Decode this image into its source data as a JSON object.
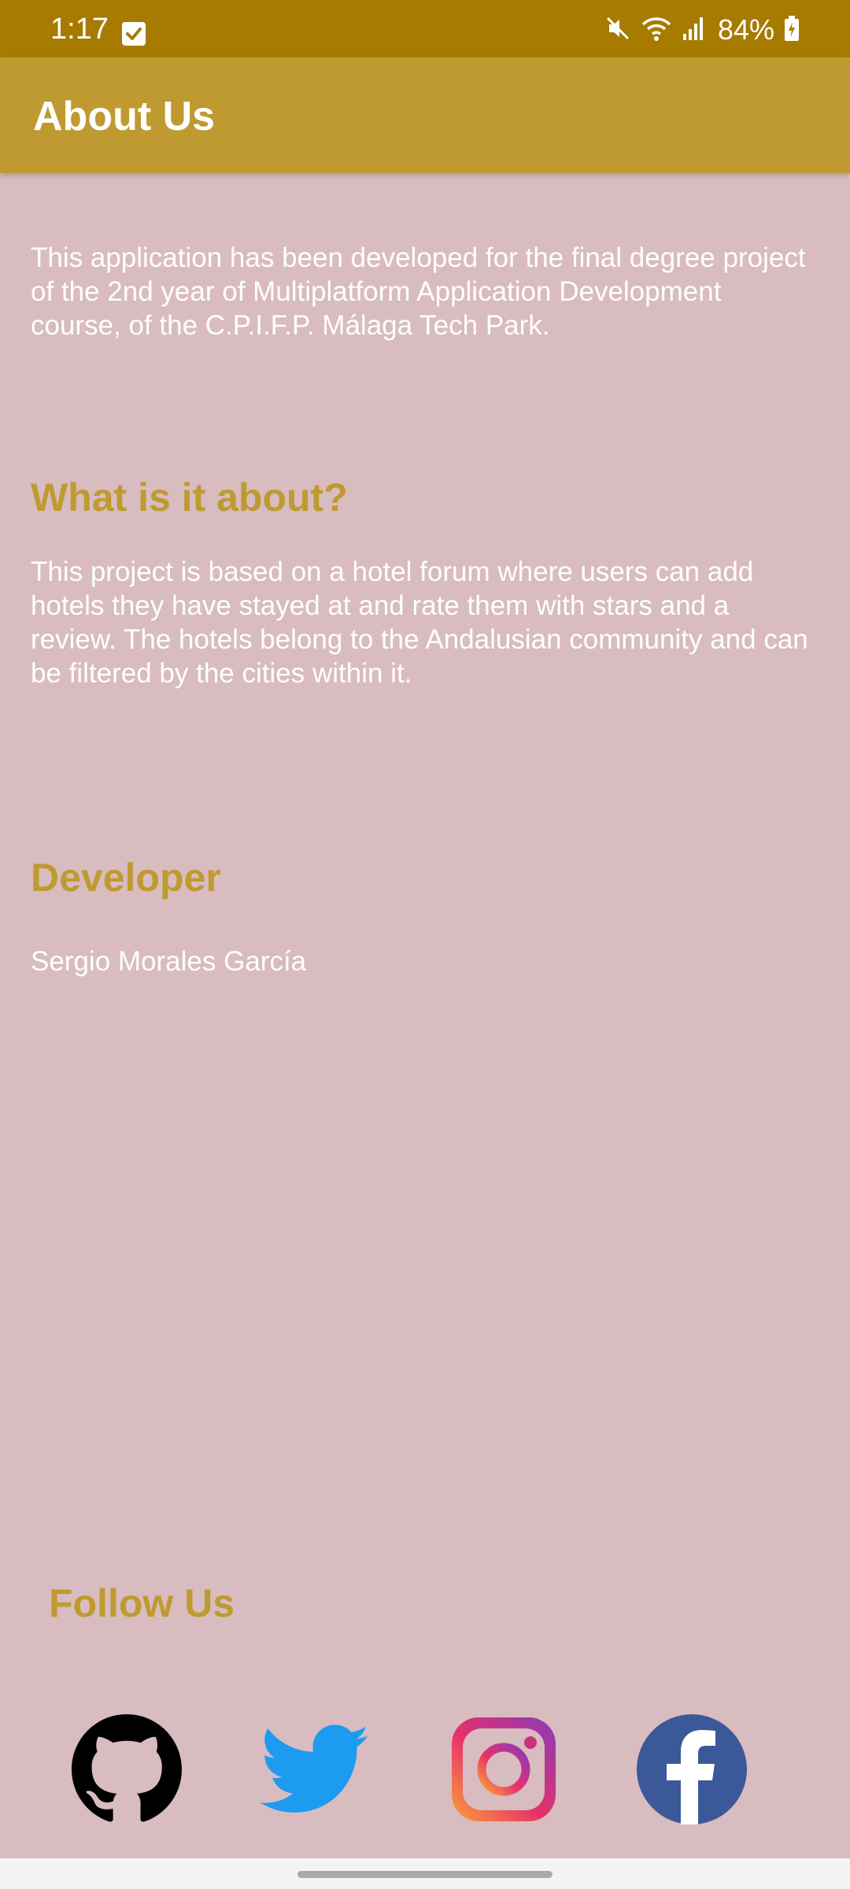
{
  "status_bar": {
    "time": "1:17",
    "battery_percent": "84%",
    "background": "#a67b00"
  },
  "app_bar": {
    "title": "About Us",
    "background": "#bf9a30"
  },
  "intro": {
    "text": "This application has been developed for the final degree project of the 2nd year of Multiplatform Application Development course, of the C.P.I.F.P. Málaga Tech Park."
  },
  "about": {
    "heading": "What is it about?",
    "text": "This project is based on a hotel forum where users can add hotels they have stayed at and rate them with stars and a review. The hotels belong to the Andalusian community and can be filtered by the cities within it."
  },
  "developer": {
    "heading": "Developer",
    "name": "Sergio Morales García"
  },
  "follow": {
    "heading": "Follow Us",
    "links": [
      {
        "icon": "github-icon"
      },
      {
        "icon": "twitter-icon"
      },
      {
        "icon": "instagram-icon"
      },
      {
        "icon": "facebook-icon"
      }
    ]
  },
  "colors": {
    "page_background": "#d8bcbf",
    "accent": "#bf9a30",
    "body_text": "#ffffff"
  }
}
